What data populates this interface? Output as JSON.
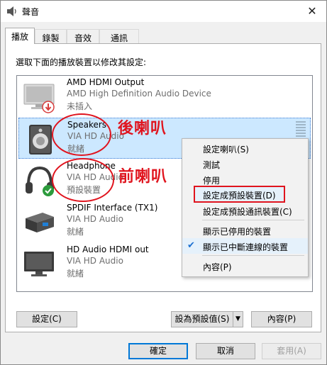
{
  "window": {
    "title": "聲音",
    "close_glyph": "✕"
  },
  "tabs": [
    "播放",
    "錄製",
    "音效",
    "通訊"
  ],
  "instructions": "選取下面的播放裝置以修改其設定:",
  "devices": [
    {
      "name": "AMD HDMI Output",
      "desc": "AMD High Definition Audio Device",
      "status": "未插入",
      "icon": "monitor-icon"
    },
    {
      "name": "Speakers",
      "desc": "VIA HD Audio",
      "status": "就緒",
      "icon": "speaker-icon"
    },
    {
      "name": "Headphone",
      "desc": "VIA HD Audio",
      "status": "預設裝置",
      "icon": "headphone-icon"
    },
    {
      "name": "SPDIF Interface (TX1)",
      "desc": "VIA HD Audio",
      "status": "就緒",
      "icon": "spdif-icon"
    },
    {
      "name": "HD Audio HDMI out",
      "desc": "VIA HD Audio",
      "status": "就緒",
      "icon": "monitor-icon"
    }
  ],
  "annotations": {
    "rear": "後喇叭",
    "front": "前喇叭"
  },
  "context_menu": {
    "items": [
      "設定喇叭(S)",
      "測試",
      "停用",
      "設定成預設裝置(D)",
      "設定成預設通訊裝置(C)",
      "顯示已停用的裝置",
      "顯示已中斷連線的裝置",
      "內容(P)"
    ],
    "checked_glyph": "✔"
  },
  "panel_buttons": {
    "configure": "設定(C)",
    "set_default": "設為預設值(S)",
    "properties": "內容(P)"
  },
  "dialog_buttons": {
    "ok": "確定",
    "cancel": "取消",
    "apply": "套用(A)"
  },
  "colors": {
    "selection": "#cce8ff",
    "accent": "#0078d7",
    "annotation": "#e0141e",
    "default_check": "#2c9b3c",
    "unplugged": "#d83b3b"
  }
}
